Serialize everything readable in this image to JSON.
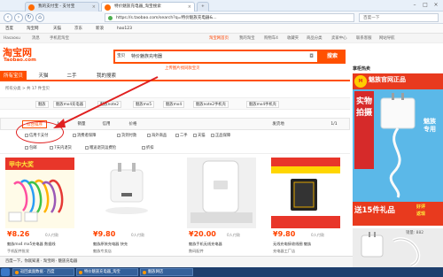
{
  "browser": {
    "tabs": [
      {
        "label": "我的支付宝 - 支付宝"
      },
      {
        "label": "特价魅族充电器_淘宝搜索"
      }
    ],
    "url": "https://s.taobao.com/search?q=特价魅族充电器&...",
    "addr_right": "百度一下"
  },
  "bookmarks": [
    "百度",
    "淘宝网",
    "天猫",
    "京东",
    "新浪",
    "hao123"
  ],
  "taobao_top": {
    "left": [
      "Hasaoxu",
      "消息",
      "手机逛淘宝"
    ],
    "right": [
      "淘宝网首页",
      "我的淘宝",
      "购物车4",
      "收藏夹",
      "商品分类",
      "卖家中心",
      "联系客服",
      "网站导航"
    ]
  },
  "logo": {
    "cn": "淘宝网",
    "en": "Taobao.com"
  },
  "search": {
    "category": "宝贝",
    "query": "特价魅族充电器",
    "button": "搜索",
    "hint": "上传图片找同款宝贝"
  },
  "nav_tabs": [
    "所有宝贝",
    "天猫",
    "二手",
    "我的搜索"
  ],
  "breadcrumb": "所有分类 > 共 17 件宝贝",
  "categories": [
    "魅族",
    "魅族mx4充电器",
    "魅族note2",
    "魅族mx5",
    "魅族mx4",
    "魅族note2手机壳",
    "魅族mx4手机壳"
  ],
  "sort": {
    "items": [
      "综合排序",
      "人气",
      "销量",
      "信用",
      "价格"
    ],
    "right": [
      "发货地",
      "1/1"
    ]
  },
  "filters": [
    "信用卡支付",
    "消费者保障",
    "货到付款",
    "海外商品",
    "二手",
    "天猫",
    "正品保障"
  ],
  "filters2": [
    "包邮",
    "7天内退货",
    "赠送退货运费险",
    "折扣"
  ],
  "products": [
    {
      "price": "¥8.26",
      "sales": "0人付款",
      "title": "魅族mx4 mx5充电器 数据线",
      "shop": "手机配件批发"
    },
    {
      "price": "¥9.80",
      "sales": "0人付款",
      "title": "魅族原装充电器 快充",
      "shop": "魅族专卖店"
    },
    {
      "price": "¥20.00",
      "sales": "0人付款",
      "title": "魅族手机无线充电器",
      "shop": "数码配件"
    },
    {
      "price": "¥9.80",
      "sales": "0人付款",
      "title": "无线充电接收线圈 魅族",
      "shop": "充电器工厂店"
    }
  ],
  "sidebar": {
    "title": "掌柜热卖",
    "ad_head": "魅族官网正品",
    "ad_vertical": "实物拍摄",
    "ad_vertical2": "魅族专用",
    "ad_bottom": "送15件礼品",
    "ad_bottom2": "好评",
    "ad_bottom3": "返现",
    "ad2_price": "销量: 882"
  },
  "status": "百度一下，你就知道 · 淘宝网 · 魅族充电器",
  "taskbar": [
    "返回桌面数据 · 百度",
    "特价魅族充电器_淘宝",
    "魅族网店"
  ]
}
